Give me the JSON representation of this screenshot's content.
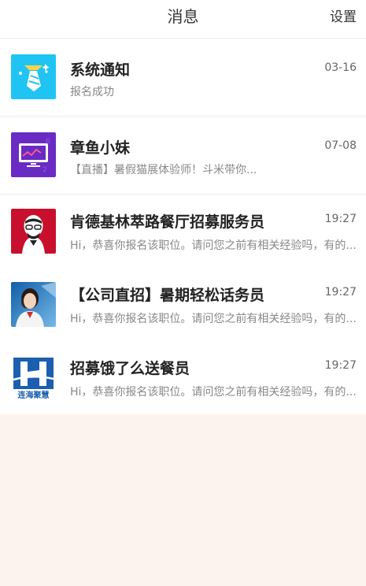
{
  "header": {
    "title": "消息",
    "settings_label": "设置"
  },
  "messages": [
    {
      "avatar": "system-notice-icon",
      "name": "系统通知",
      "time": "03-16",
      "preview": "报名成功"
    },
    {
      "avatar": "live-tv-icon",
      "name": "章鱼小妹",
      "time": "07-08",
      "preview": "【直播】暑假猫展体验师！斗米带你..."
    },
    {
      "avatar": "kfc-logo",
      "name": "肯德基林萃路餐厅招募服务员",
      "time": "19:27",
      "preview": "Hi，恭喜你报名该职位。请问您之前有相关经验吗，有的..."
    },
    {
      "avatar": "agent-photo",
      "name": "【公司直招】暑期轻松话务员",
      "time": "19:27",
      "preview": "Hi，恭喜你报名该职位。请问您之前有相关经验吗，有的..."
    },
    {
      "avatar": "company-logo",
      "name": "招募饿了么送餐员",
      "time": "19:27",
      "preview": "Hi，恭喜你报名该职位。请问您之前有相关经验吗，有的...",
      "logo_text": "连海聚慧"
    }
  ]
}
